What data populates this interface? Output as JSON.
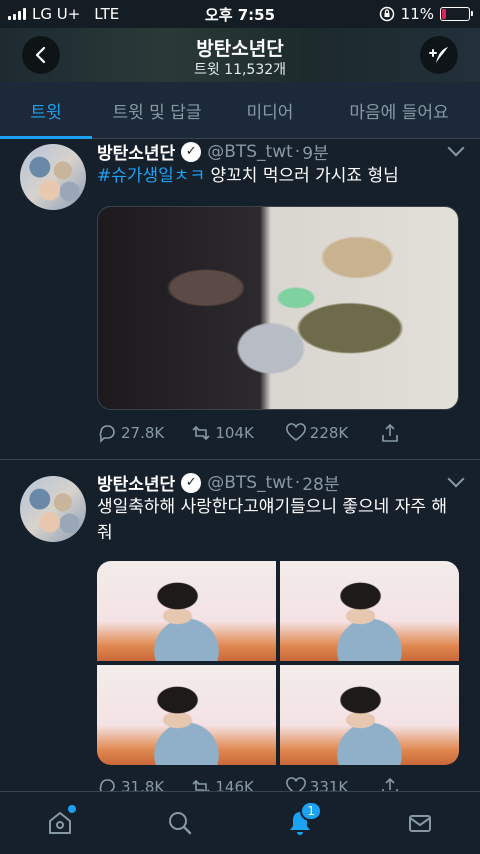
{
  "status_bar": {
    "carrier": "LG U+",
    "network": "LTE",
    "time": "오후 7:55",
    "battery": "11%"
  },
  "header": {
    "title": "방탄소년단",
    "subtitle": "트윗 11,532개"
  },
  "tabs": [
    {
      "label": "트윗"
    },
    {
      "label": "트윗 및 답글"
    },
    {
      "label": "미디어"
    },
    {
      "label": "마음에 들어요"
    }
  ],
  "tweets": [
    {
      "name": "방탄소년단",
      "handle": "@BTS_twt",
      "separator": "·",
      "time": "9분",
      "hashtag": "#슈가생일ㅊㅋ",
      "text": "양꼬치 먹으러 가시죠 형님",
      "replies": "27.8K",
      "retweets": "104K",
      "likes": "228K"
    },
    {
      "name": "방탄소년단",
      "handle": "@BTS_twt",
      "separator": "·",
      "time": "28분",
      "text": "생일축하해 사랑한다고얘기들으니 좋으네 자주 해줘",
      "replies": "31.8K",
      "retweets": "146K",
      "likes": "331K"
    }
  ],
  "bottom_nav": {
    "items": [
      "home-icon",
      "search-icon",
      "notifications-icon",
      "messages-icon"
    ],
    "notification_count": "1"
  },
  "colors": {
    "background": "#15202b",
    "accent": "#1da1f2",
    "secondary_text": "#8899a6",
    "battery_low": "#e0245e"
  }
}
